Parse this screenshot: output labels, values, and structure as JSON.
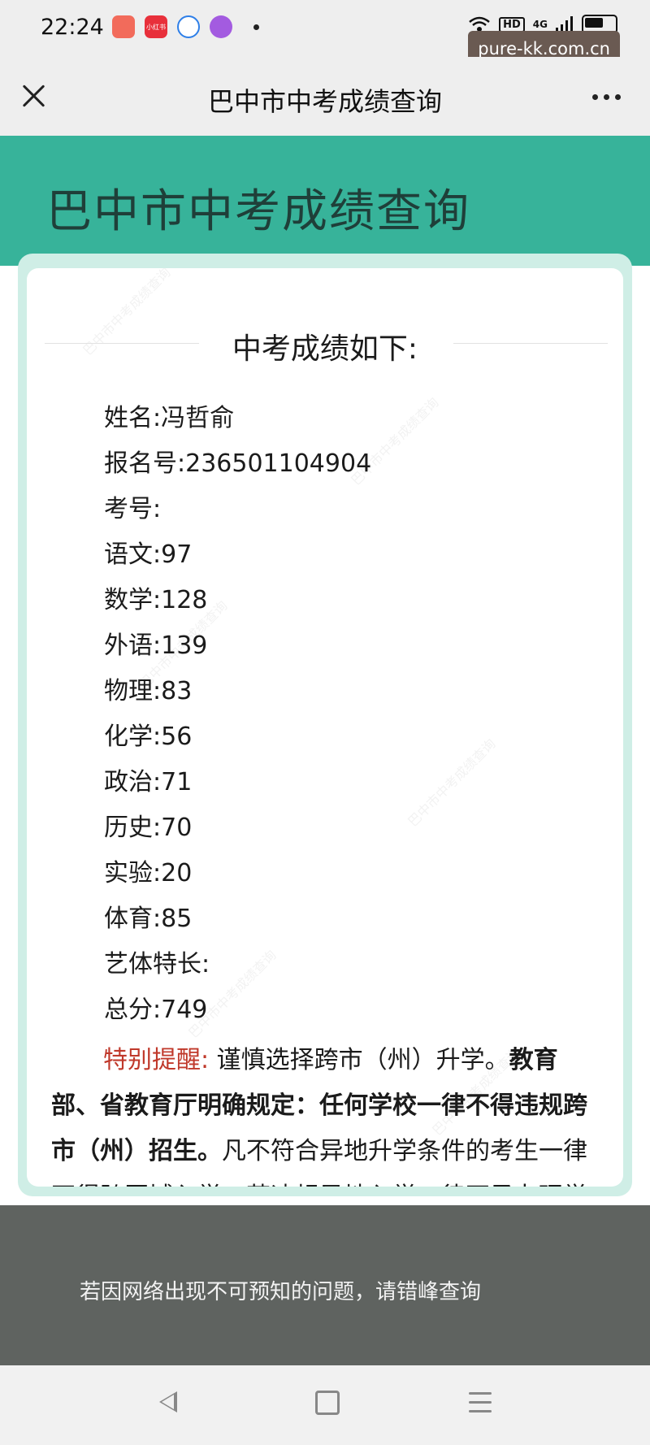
{
  "status_bar": {
    "time": "22:24",
    "app_icons": [
      {
        "name": "app-icon-1",
        "color": "#f26b5b",
        "text": ""
      },
      {
        "name": "xiaohongshu-icon",
        "color": "#e8303b",
        "text": "小红书"
      },
      {
        "name": "app-icon-3",
        "color": "#2e7fe8",
        "text": ""
      },
      {
        "name": "app-icon-4",
        "color": "#a35be0",
        "text": ""
      }
    ],
    "network_label": "4G",
    "hd_label": "HD"
  },
  "watermark_tag": "pure-kk.com.cn",
  "title_bar": {
    "title": "巴中市中考成绩查询"
  },
  "header": {
    "title": "巴中市中考成绩查询"
  },
  "card": {
    "heading": "中考成绩如下:",
    "rows": [
      "姓名:冯哲俞",
      "报名号:236501104904",
      "考号:",
      "语文:97",
      "数学:128",
      "外语:139",
      "物理:83",
      "化学:56",
      "政治:71",
      "历史:70",
      "实验:20",
      "体育:85",
      "艺体特长:",
      "总分:749"
    ],
    "notice": {
      "label": "特别提醒:",
      "text1": "谨慎选择跨市（州）升学。",
      "bold": "教育部、省教育厅明确规定：任何学校一律不得违规跨市（州）招生。",
      "text2": "凡不符合异地升学条件的考生一律不得跨区域入学，若违规异地入学一律不予办理学籍手续，所造成的一切后果自负。"
    }
  },
  "overlay": {
    "tip": "若因网络出现不可预知的问题，请错峰查询"
  },
  "colors": {
    "header_bg": "#37b39a",
    "header_text": "#1f3f39",
    "notice_label": "#c0392b",
    "overlay_bg": "#5f6360"
  }
}
